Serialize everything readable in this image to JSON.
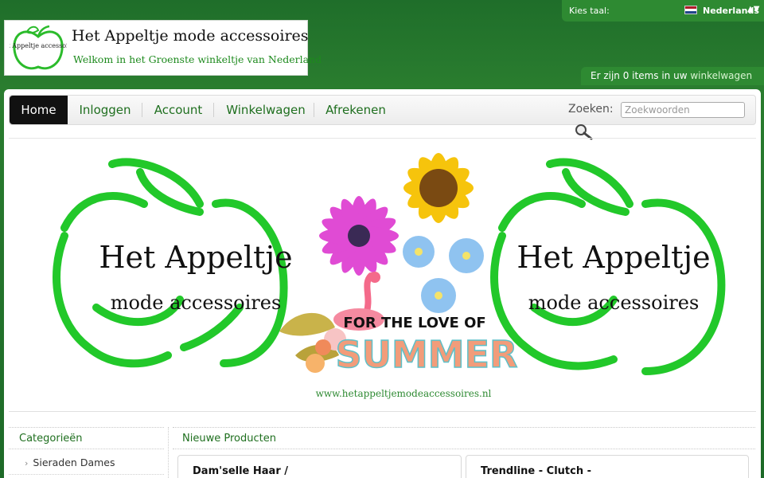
{
  "logo": {
    "title": "Het Appeltje mode accessoires",
    "subtitle": "Welkom in het Groenste winkeltje van Nederland",
    "icon_text": "Het Appeltje accessoires"
  },
  "language": {
    "label": "Kies taal:",
    "value": "Nederlands",
    "caret": "▲▼",
    "flag_icon": "flag-netherlands-icon"
  },
  "cart": {
    "text": "Er zijn 0 items in uw ",
    "link": "winkelwagen"
  },
  "nav": {
    "items": [
      {
        "label": "Home",
        "active": true
      },
      {
        "label": "Inloggen"
      },
      {
        "label": "Account"
      },
      {
        "label": "Winkelwagen"
      },
      {
        "label": "Afrekenen"
      }
    ]
  },
  "search": {
    "label": "Zoeken:",
    "placeholder": "Zoekwoorden",
    "value": ""
  },
  "banner": {
    "left_title": "Het Appeltje",
    "left_sub": "mode accessoires",
    "right_title": "Het Appeltje",
    "right_sub": "mode accessoires",
    "tagline": "FOR THE LOVE OF",
    "headline": "SUMMER",
    "url": "www.hetappeltjemodeaccessoires.nl"
  },
  "sidebar": {
    "heading": "Categorieën",
    "items": [
      {
        "label": "Sieraden Dames"
      }
    ]
  },
  "main": {
    "heading": "Nieuwe Producten",
    "products": [
      {
        "title": "Dam'selle Haar /"
      },
      {
        "title": "Trendline - Clutch -"
      }
    ]
  },
  "colors": {
    "background": "#1f6e2a",
    "accent": "#2e8a32",
    "link": "#1f6f1f",
    "apple_green": "#22c82a"
  }
}
